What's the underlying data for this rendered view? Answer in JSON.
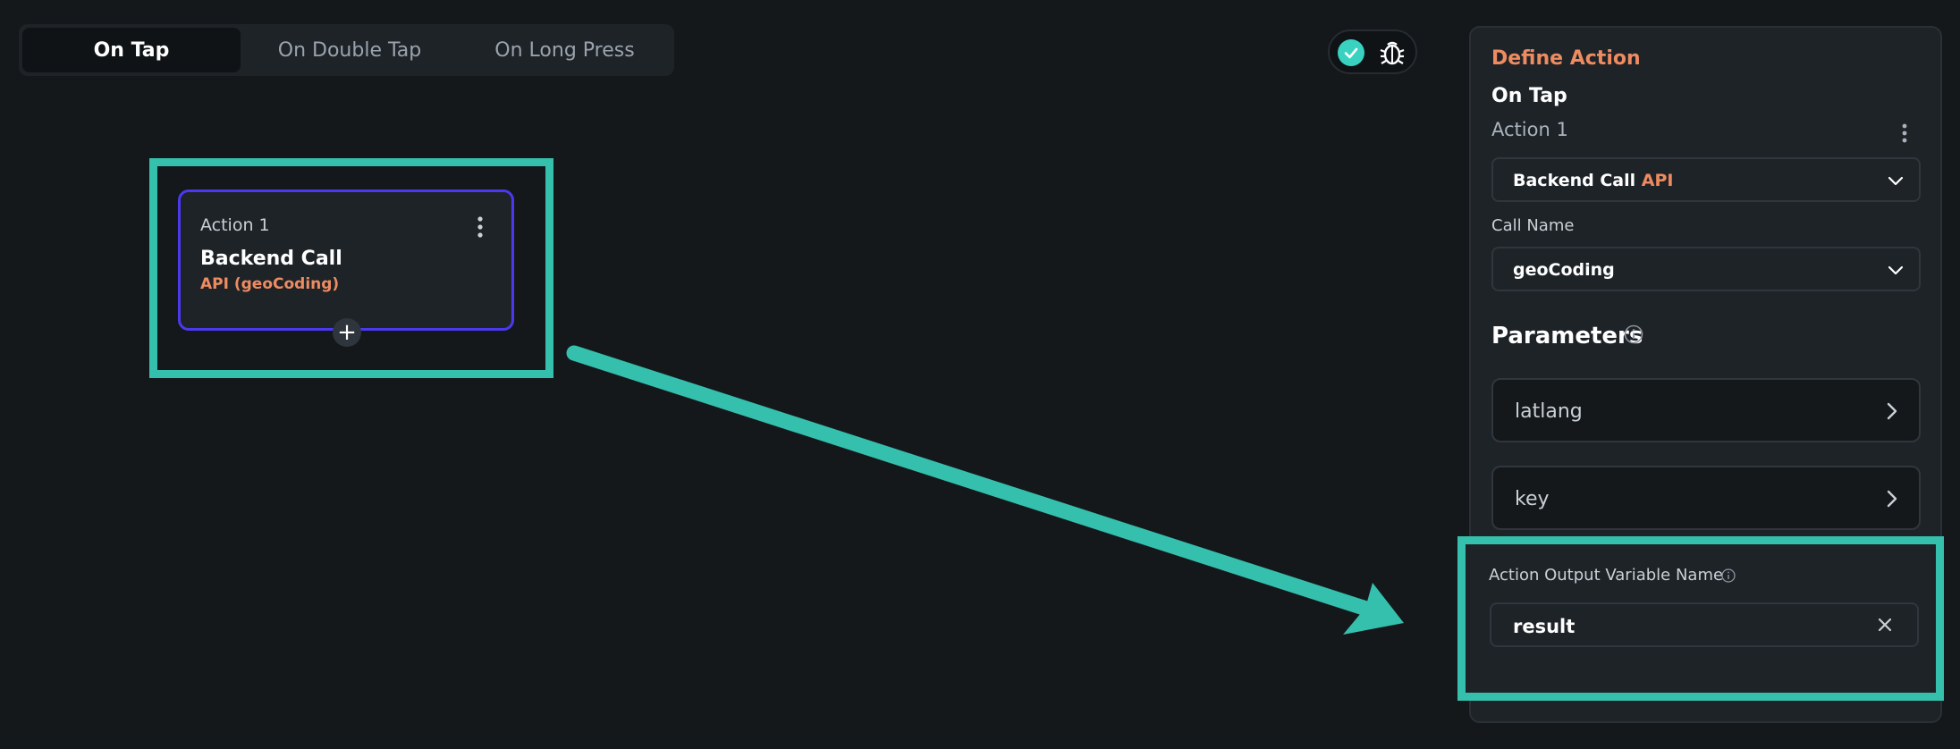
{
  "tabs": [
    {
      "label": "On Tap",
      "active": true
    },
    {
      "label": "On Double Tap",
      "active": false
    },
    {
      "label": "On Long Press",
      "active": false
    }
  ],
  "toolbar": {
    "toggle_icon": "check-icon",
    "debug_icon": "bug-icon"
  },
  "canvas": {
    "action_card": {
      "action_label": "Action 1",
      "title": "Backend Call",
      "subtitle": "API (geoCoding)"
    },
    "add_button_glyph": "+"
  },
  "panel": {
    "heading": "Define Action",
    "event": "On Tap",
    "action_label": "Action 1",
    "action_type": {
      "name": "Backend Call",
      "tag": "API"
    },
    "call_name_label": "Call Name",
    "call_name_value": "geoCoding",
    "parameters_title": "Parameters",
    "parameters": [
      "latlang",
      "key"
    ],
    "output_label": "Action Output Variable Name",
    "output_value": "result"
  },
  "colors": {
    "accent_orange": "#ee8b60",
    "highlight_teal": "#35c0ad",
    "card_border": "#4b39ef",
    "check_teal": "#39d2c0"
  }
}
